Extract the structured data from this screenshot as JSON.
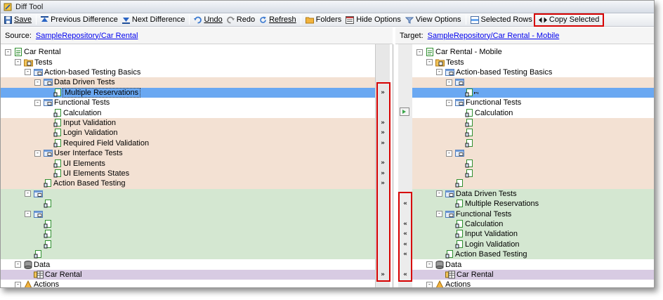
{
  "window": {
    "title": "Diff Tool"
  },
  "toolbar": {
    "save": "Save",
    "previous_difference": "Previous Difference",
    "next_difference": "Next Difference",
    "undo": "Undo",
    "redo": "Redo",
    "refresh": "Refresh",
    "folders": "Folders",
    "hide_options": "Hide Options",
    "view_options": "View Options",
    "selected_rows": "Selected Rows",
    "copy_selected": "Copy Selected"
  },
  "source": {
    "label": "Source:",
    "path": "SampleRepository/Car Rental",
    "rows": [
      {
        "text": "Car Rental",
        "level": 0,
        "icon": "project-icon",
        "toggle": "-",
        "state": "normal"
      },
      {
        "text": "Tests",
        "level": 1,
        "icon": "tests-folder-icon",
        "toggle": "-",
        "state": "normal"
      },
      {
        "text": "Action-based Testing Basics",
        "level": 2,
        "icon": "folder-icon",
        "toggle": "-",
        "state": "normal"
      },
      {
        "text": "Data Driven Tests",
        "level": 3,
        "icon": "folder-icon",
        "toggle": "-",
        "state": "changed"
      },
      {
        "text": "Multiple Reservations",
        "level": 4,
        "icon": "test-icon",
        "toggle": "",
        "state": "selected"
      },
      {
        "text": "Functional Tests",
        "level": 3,
        "icon": "folder-icon",
        "toggle": "-",
        "state": "normal"
      },
      {
        "text": "Calculation",
        "level": 4,
        "icon": "test-icon",
        "toggle": "",
        "state": "normal"
      },
      {
        "text": "Input Validation",
        "level": 4,
        "icon": "test-icon",
        "toggle": "",
        "state": "changed"
      },
      {
        "text": "Login Validation",
        "level": 4,
        "icon": "test-icon",
        "toggle": "",
        "state": "changed"
      },
      {
        "text": "Required Field Validation",
        "level": 4,
        "icon": "test-icon",
        "toggle": "",
        "state": "changed"
      },
      {
        "text": "User Interface Tests",
        "level": 3,
        "icon": "folder-icon",
        "toggle": "-",
        "state": "changed"
      },
      {
        "text": "UI Elements",
        "level": 4,
        "icon": "test-icon",
        "toggle": "",
        "state": "changed"
      },
      {
        "text": "UI Elements States",
        "level": 4,
        "icon": "test-icon",
        "toggle": "",
        "state": "changed"
      },
      {
        "text": "Action Based Testing",
        "level": 3,
        "icon": "test-icon",
        "toggle": "",
        "state": "changed"
      },
      {
        "text": "",
        "level": 2,
        "icon": "folder-icon",
        "toggle": "-",
        "state": "added"
      },
      {
        "text": "",
        "level": 3,
        "icon": "test-icon",
        "toggle": "",
        "state": "added"
      },
      {
        "text": "",
        "level": 2,
        "icon": "folder-icon",
        "toggle": "-",
        "state": "added"
      },
      {
        "text": "",
        "level": 3,
        "icon": "test-icon",
        "toggle": "",
        "state": "added"
      },
      {
        "text": "",
        "level": 3,
        "icon": "test-icon",
        "toggle": "",
        "state": "added"
      },
      {
        "text": "",
        "level": 3,
        "icon": "test-icon",
        "toggle": "",
        "state": "added"
      },
      {
        "text": "",
        "level": 2,
        "icon": "test-icon",
        "toggle": "",
        "state": "added"
      },
      {
        "text": "Data",
        "level": 1,
        "icon": "data-icon",
        "toggle": "-",
        "state": "normal"
      },
      {
        "text": "Car Rental",
        "level": 2,
        "icon": "dataset-icon",
        "toggle": "",
        "state": "purple"
      },
      {
        "text": "Actions",
        "level": 1,
        "icon": "actions-icon",
        "toggle": "-",
        "state": "normal"
      }
    ]
  },
  "target": {
    "label": "Target:",
    "path": "SampleRepository/Car Rental - Mobile",
    "rows": [
      {
        "text": "Car Rental - Mobile",
        "level": 0,
        "icon": "project-icon",
        "toggle": "-",
        "state": "normal"
      },
      {
        "text": "Tests",
        "level": 1,
        "icon": "tests-folder-icon",
        "toggle": "-",
        "state": "normal"
      },
      {
        "text": "Action-based Testing Basics",
        "level": 2,
        "icon": "folder-icon",
        "toggle": "-",
        "state": "normal"
      },
      {
        "text": "",
        "level": 3,
        "icon": "folder-icon",
        "toggle": "-",
        "state": "changed"
      },
      {
        "text": "",
        "level": 4,
        "icon": "test-icon",
        "toggle": "",
        "state": "selected"
      },
      {
        "text": "Functional Tests",
        "level": 3,
        "icon": "folder-icon",
        "toggle": "-",
        "state": "normal"
      },
      {
        "text": "Calculation",
        "level": 4,
        "icon": "test-icon",
        "toggle": "",
        "state": "normal"
      },
      {
        "text": "",
        "level": 4,
        "icon": "test-icon",
        "toggle": "",
        "state": "changed"
      },
      {
        "text": "",
        "level": 4,
        "icon": "test-icon",
        "toggle": "",
        "state": "changed"
      },
      {
        "text": "",
        "level": 4,
        "icon": "test-icon",
        "toggle": "",
        "state": "changed"
      },
      {
        "text": "",
        "level": 3,
        "icon": "folder-icon",
        "toggle": "-",
        "state": "changed"
      },
      {
        "text": "",
        "level": 4,
        "icon": "test-icon",
        "toggle": "",
        "state": "changed"
      },
      {
        "text": "",
        "level": 4,
        "icon": "test-icon",
        "toggle": "",
        "state": "changed"
      },
      {
        "text": "",
        "level": 3,
        "icon": "test-icon",
        "toggle": "",
        "state": "changed"
      },
      {
        "text": "Data Driven Tests",
        "level": 2,
        "icon": "folder-icon",
        "toggle": "-",
        "state": "added"
      },
      {
        "text": "Multiple Reservations",
        "level": 3,
        "icon": "test-icon",
        "toggle": "",
        "state": "added"
      },
      {
        "text": "Functional Tests",
        "level": 2,
        "icon": "folder-icon",
        "toggle": "-",
        "state": "added"
      },
      {
        "text": "Calculation",
        "level": 3,
        "icon": "test-icon",
        "toggle": "",
        "state": "added"
      },
      {
        "text": "Input Validation",
        "level": 3,
        "icon": "test-icon",
        "toggle": "",
        "state": "added"
      },
      {
        "text": "Login Validation",
        "level": 3,
        "icon": "test-icon",
        "toggle": "",
        "state": "added"
      },
      {
        "text": "Action Based Testing",
        "level": 2,
        "icon": "test-icon",
        "toggle": "",
        "state": "added"
      },
      {
        "text": "Data",
        "level": 1,
        "icon": "data-icon",
        "toggle": "-",
        "state": "normal"
      },
      {
        "text": "Car Rental",
        "level": 2,
        "icon": "dataset-icon",
        "toggle": "",
        "state": "purple"
      },
      {
        "text": "Actions",
        "level": 1,
        "icon": "actions-icon",
        "toggle": "-",
        "state": "normal"
      }
    ]
  },
  "merge_left_arrows": [
    {
      "row": 4,
      "glyph": "»"
    },
    {
      "row": 7,
      "glyph": "»"
    },
    {
      "row": 8,
      "glyph": "»"
    },
    {
      "row": 9,
      "glyph": "»"
    },
    {
      "row": 11,
      "glyph": "»"
    },
    {
      "row": 12,
      "glyph": "»"
    },
    {
      "row": 13,
      "glyph": "»"
    },
    {
      "row": 22,
      "glyph": "»"
    }
  ],
  "merge_right_arrows": [
    {
      "row": 15,
      "glyph": "«"
    },
    {
      "row": 17,
      "glyph": "«"
    },
    {
      "row": 18,
      "glyph": "«"
    },
    {
      "row": 19,
      "glyph": "«"
    },
    {
      "row": 20,
      "glyph": "«"
    },
    {
      "row": 22,
      "glyph": "«"
    }
  ]
}
